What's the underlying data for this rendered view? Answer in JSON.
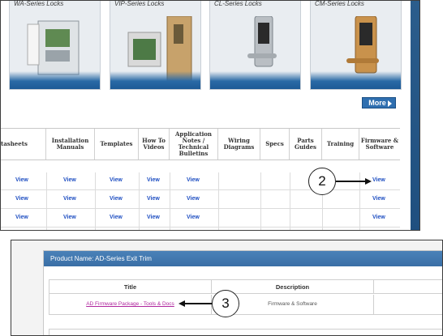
{
  "products": [
    {
      "name": "WA-Series Locks"
    },
    {
      "name": "VIP-Series Locks"
    },
    {
      "name": "CL-Series Locks"
    },
    {
      "name": "CM-Series Locks"
    }
  ],
  "more_button": {
    "label": "More"
  },
  "columns": [
    "tasheets",
    "Installation Manuals",
    "Templates",
    "How To Videos",
    "Application Notes / Technical Bulletins",
    "Wiring Diagrams",
    "Specs",
    "Parts Guides",
    "Training",
    "Firmware & Software"
  ],
  "view_label": "View",
  "callout_2": "2",
  "callout_3": "3",
  "product_panel": {
    "title": "Product Name: AD-Series Exit Trim",
    "col_title": "Title",
    "col_description": "Description",
    "row": {
      "title": "AD Firmware Package - Tools & Docs",
      "description": "Firmware & Software"
    }
  },
  "colors": {
    "link": "#1f4fc2",
    "accent": "#2f6fb0",
    "package_link": "#b0269e"
  },
  "icons": [
    "arrow-right-icon"
  ]
}
